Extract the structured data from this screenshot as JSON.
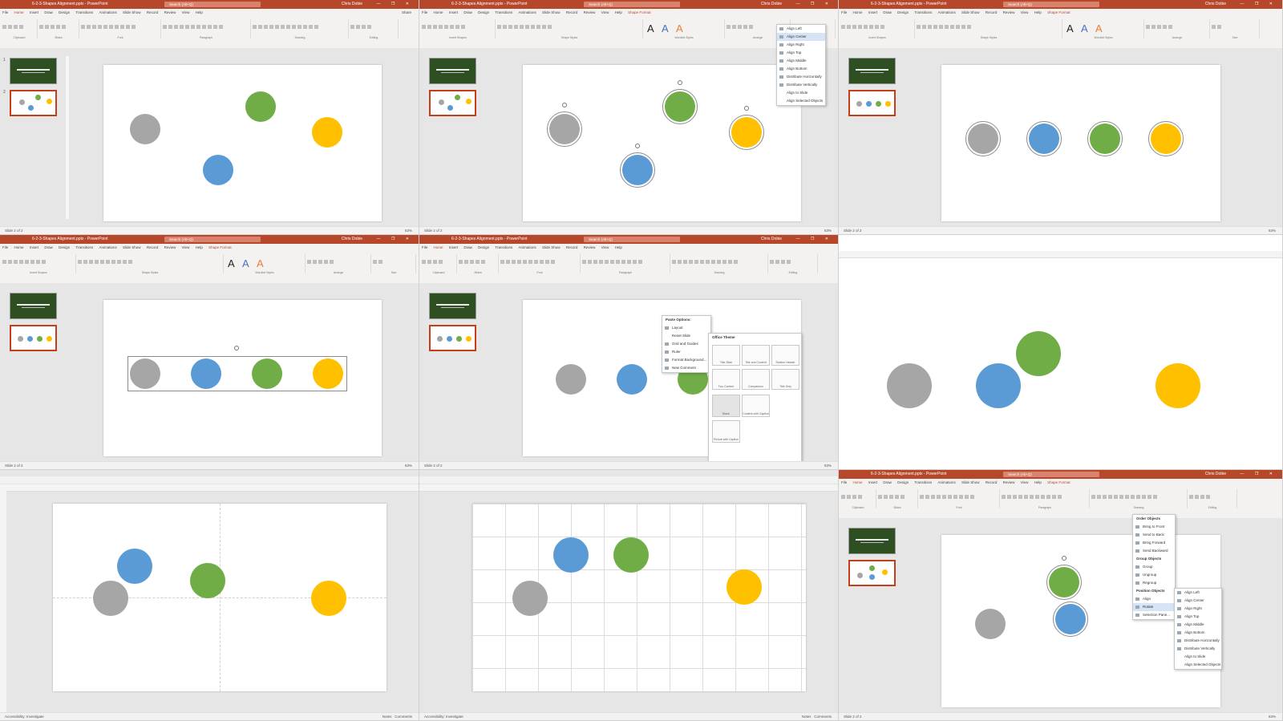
{
  "app": {
    "title": "6-2-3-Shapes Alignment.pptx - PowerPoint",
    "search_placeholder": "Search (Alt+Q)",
    "user": "Chris Dobie",
    "window_controls": "— ❐ ✕",
    "share": "Share"
  },
  "tabs": [
    "File",
    "Home",
    "Insert",
    "Draw",
    "Design",
    "Transitions",
    "Animations",
    "Slide Show",
    "Record",
    "Review",
    "View",
    "Help",
    "Shape Format"
  ],
  "ribbon": {
    "groups": [
      "Clipboard",
      "Slides",
      "Font",
      "Paragraph",
      "Drawing",
      "Editing",
      "Insert Shapes",
      "Shape Styles",
      "WordArt Styles",
      "Arrange",
      "Size"
    ],
    "wordart": [
      "A",
      "A",
      "A"
    ]
  },
  "thumbnails": {
    "slide1_title": "SHORT ANIMATIONS",
    "numbers": [
      "1",
      "2"
    ]
  },
  "colors": {
    "gray": "#a6a6a6",
    "blue": "#5b9bd5",
    "green": "#70ad47",
    "yellow": "#ffc000",
    "accent": "#b7472a"
  },
  "align_menu": {
    "items": [
      "Align Left",
      "Align Center",
      "Align Right",
      "Align Top",
      "Align Middle",
      "Align Bottom",
      "Distribute Horizontally",
      "Distribute Vertically",
      "Align to Slide",
      "Align Selected Objects"
    ]
  },
  "context_menu": {
    "paste_header": "Paste Options:",
    "items": [
      "Layout",
      "Reset Slide",
      "Grid and Guides",
      "Ruler",
      "Format Background...",
      "New Comment"
    ],
    "layout_header": "Office Theme",
    "layouts": [
      "Title Slide",
      "Title and Content",
      "Section Header",
      "Two Content",
      "Comparison",
      "Title Only",
      "Blank",
      "Content with Caption",
      "Picture with Caption"
    ]
  },
  "arrange_menu": {
    "order_header": "Order Objects",
    "order": [
      "Bring to Front",
      "Send to Back",
      "Bring Forward",
      "Send Backward"
    ],
    "group_header": "Group Objects",
    "group": [
      "Group",
      "Ungroup",
      "Regroup"
    ],
    "position_header": "Position Objects",
    "position": [
      "Align",
      "Rotate",
      "Selection Pane..."
    ]
  },
  "statusbar": {
    "slide": "Slide 2 of 2",
    "accessibility": "Accessibility: Investigate",
    "notes": "Notes",
    "comments": "Comments",
    "zoom": "63%"
  }
}
